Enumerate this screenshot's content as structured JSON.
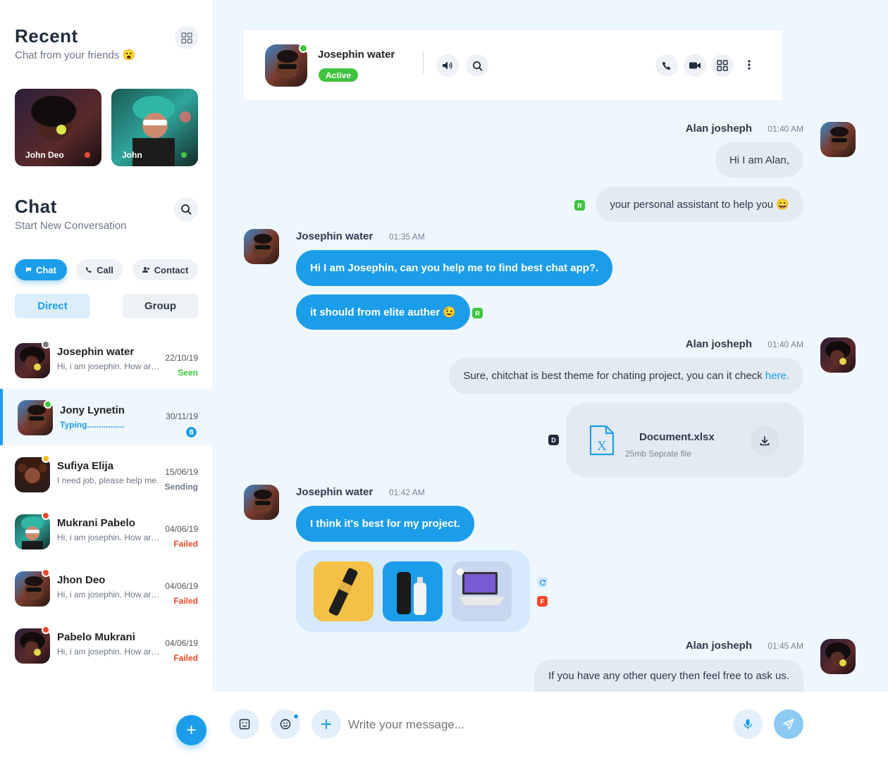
{
  "sidebar": {
    "recent": {
      "title": "Recent",
      "subtitle": "Chat from your friends 😮"
    },
    "stories": [
      {
        "name": "John Deo",
        "status_color": "#ef4b2b"
      },
      {
        "name": "John",
        "status_color": "#3ec43e"
      }
    ],
    "chat": {
      "title": "Chat",
      "subtitle": "Start New Conversation"
    },
    "tabs": [
      {
        "label": "Chat",
        "icon": "flag-icon"
      },
      {
        "label": "Call",
        "icon": "phone-icon"
      },
      {
        "label": "Contact",
        "icon": "contacts-icon"
      }
    ],
    "segments": [
      {
        "label": "Direct"
      },
      {
        "label": "Group"
      }
    ],
    "conversations": [
      {
        "name": "Josephin water",
        "preview": "Hi, i am josephin. How are you.. ! There are many variations of passages.",
        "date": "22/10/19",
        "status": "Seen",
        "status_color": "#3ec43e",
        "dot_color": "#7b7b7b"
      },
      {
        "name": "Jony Lynetin",
        "preview": "Typing................",
        "date": "30/11/19",
        "badge": "8",
        "dot_color": "#3ec43e"
      },
      {
        "name": "Sufiya Elija",
        "preview": "I need job, please help me.",
        "date": "15/06/19",
        "status": "Sending",
        "status_color": "#6b7685",
        "dot_color": "#f5c02a"
      },
      {
        "name": "Mukrani Pabelo",
        "preview": "Hi, i am josephin. How are you.. ! There are many variations of passages.",
        "date": "04/06/19",
        "status": "Failed",
        "status_color": "#ef4b2b",
        "dot_color": "#ef4b2b"
      },
      {
        "name": "Jhon Deo",
        "preview": "Hi, i am josephin. How are you.. ! There are many variations of passages.",
        "date": "04/06/19",
        "status": "Failed",
        "status_color": "#ef4b2b",
        "dot_color": "#ef4b2b"
      },
      {
        "name": "Pabelo Mukrani",
        "preview": "Hi, i am josephin. How are you.. ! There are many variations of passages.",
        "date": "04/06/19",
        "status": "Failed",
        "status_color": "#ef4b2b",
        "dot_color": "#ef4b2b"
      }
    ],
    "fab_label": "+"
  },
  "header": {
    "name": "Josephin water",
    "status": "Active"
  },
  "messages": {
    "m1": {
      "name": "Alan josheph",
      "time": "01:40 AM",
      "bubbles": [
        "Hi I am Alan,",
        "your personal assistant to help you 😀"
      ],
      "tag": "R"
    },
    "m2": {
      "name": "Josephin water",
      "time": "01:35 AM",
      "bubbles": [
        "Hi I am Josephin, can you help me to find best chat app?.",
        "it should from elite auther 😉"
      ],
      "tag": "R"
    },
    "m3": {
      "name": "Alan josheph",
      "time": "01:40 AM",
      "text": "Sure, chitchat is best theme for chating project, you can it check ",
      "link": "here.",
      "tag": "D",
      "file": {
        "name": "Document.xlsx",
        "meta": "25mb Seprate file"
      }
    },
    "m4": {
      "name": "Josephin water",
      "time": "01:42 AM",
      "text": "I think it's best for my project.",
      "tag": "F"
    },
    "m5": {
      "name": "Alan josheph",
      "time": "01:45 AM",
      "text": "If you have any other query then feel free to ask us."
    }
  },
  "composer": {
    "placeholder": "Write your message..."
  },
  "colors": {
    "accent": "#1c9dea",
    "background": "#eef6fe",
    "online": "#3ec43e",
    "failed": "#ef4b2b"
  }
}
